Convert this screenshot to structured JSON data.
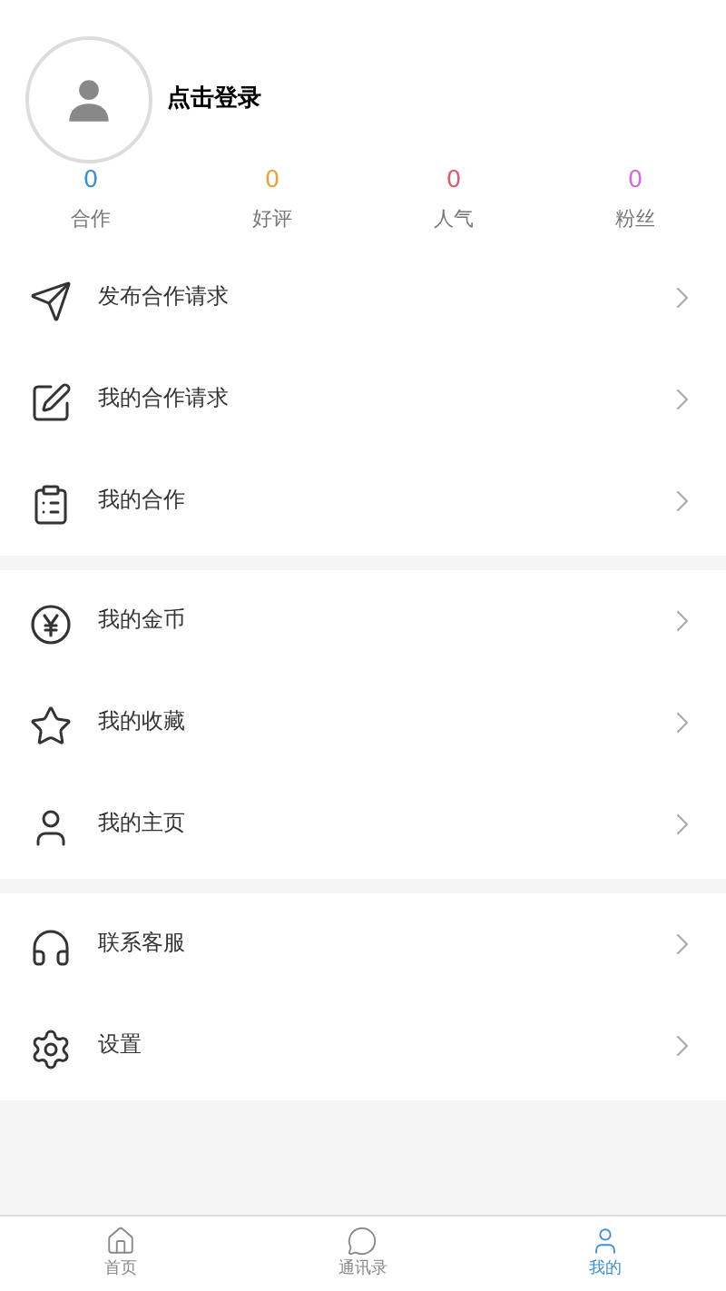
{
  "profile": {
    "login_text": "点击登录"
  },
  "stats": [
    {
      "value": "0",
      "label": "合作",
      "color": "#3b8fd6"
    },
    {
      "value": "0",
      "label": "好评",
      "color": "#e6a23c"
    },
    {
      "value": "0",
      "label": "人气",
      "color": "#e05b6d"
    },
    {
      "value": "0",
      "label": "粉丝",
      "color": "#d66bdc"
    }
  ],
  "menu_groups": [
    [
      {
        "kind": "send",
        "label": "发布合作请求"
      },
      {
        "kind": "edit",
        "label": "我的合作请求"
      },
      {
        "kind": "clipboard",
        "label": "我的合作"
      }
    ],
    [
      {
        "kind": "yen",
        "label": "我的金币"
      },
      {
        "kind": "star",
        "label": "我的收藏"
      },
      {
        "kind": "user",
        "label": "我的主页"
      }
    ],
    [
      {
        "kind": "headset",
        "label": "联系客服"
      },
      {
        "kind": "gear",
        "label": "设置"
      }
    ]
  ],
  "tab_bar": [
    {
      "kind": "home",
      "label": "首页",
      "selected": false
    },
    {
      "kind": "chat",
      "label": "通讯录",
      "selected": false
    },
    {
      "kind": "user",
      "label": "我的",
      "selected": true
    }
  ]
}
